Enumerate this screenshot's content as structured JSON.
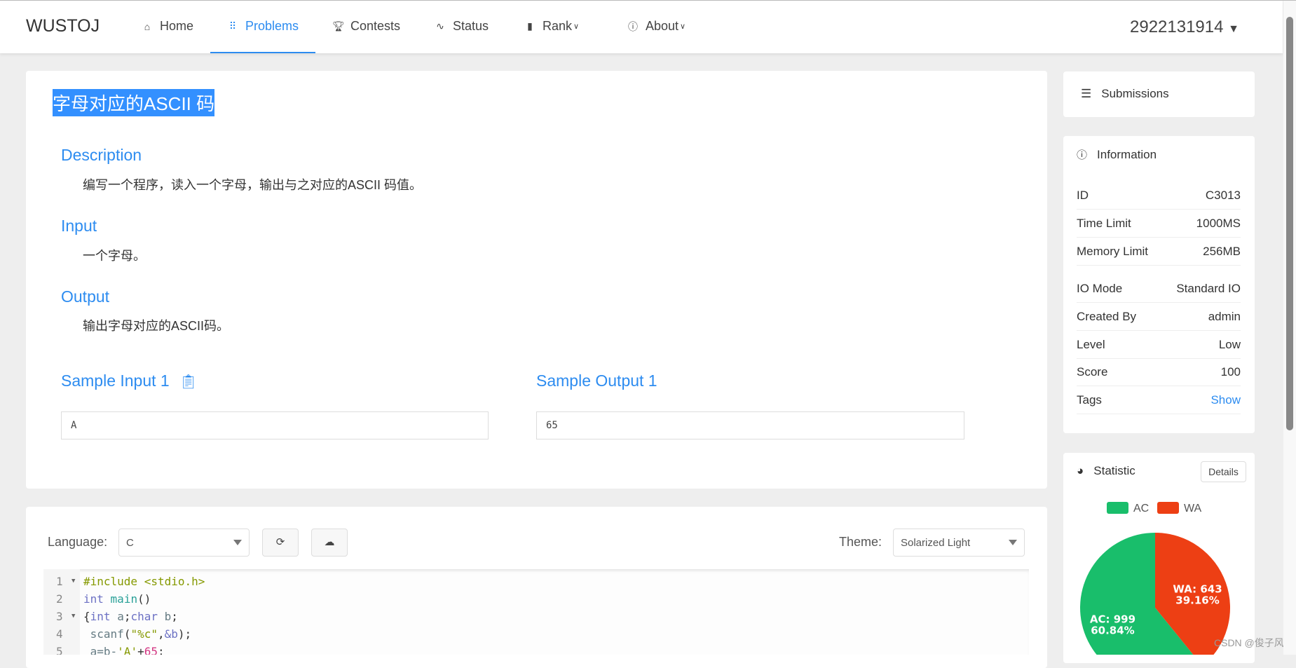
{
  "nav": {
    "logo": "WUSTOJ",
    "items": [
      {
        "label": "Home",
        "icon": "home-icon"
      },
      {
        "label": "Problems",
        "icon": "grid-icon",
        "active": true
      },
      {
        "label": "Contests",
        "icon": "trophy-icon"
      },
      {
        "label": "Status",
        "icon": "pulse-icon"
      },
      {
        "label": "Rank",
        "icon": "bar-chart-icon"
      },
      {
        "label": "About",
        "icon": "info-icon"
      }
    ],
    "user": "2922131914"
  },
  "problem": {
    "title": "字母对应的ASCII 码",
    "description_h": "Description",
    "description": "编写一个程序，读入一个字母，输出与之对应的ASCII 码值。",
    "input_h": "Input",
    "input": "一个字母。",
    "output_h": "Output",
    "output": "输出字母对应的ASCII码。",
    "sample_input_h": "Sample Input 1",
    "sample_input": "A",
    "sample_output_h": "Sample Output 1",
    "sample_output": "65"
  },
  "editor": {
    "language_label": "Language:",
    "language": "C",
    "theme_label": "Theme:",
    "theme": "Solarized Light",
    "lines": [
      "1",
      "2",
      "3",
      "4",
      "5"
    ]
  },
  "sidebar": {
    "submissions": "Submissions",
    "information": "Information",
    "info": [
      {
        "k": "ID",
        "v": "C3013"
      },
      {
        "k": "Time Limit",
        "v": "1000MS"
      },
      {
        "k": "Memory Limit",
        "v": "256MB"
      },
      {
        "k": "IO Mode",
        "v": "Standard IO"
      },
      {
        "k": "Created By",
        "v": "admin"
      },
      {
        "k": "Level",
        "v": "Low"
      },
      {
        "k": "Score",
        "v": "100"
      },
      {
        "k": "Tags",
        "v": "Show"
      }
    ],
    "statistic": "Statistic",
    "details": "Details"
  },
  "chart_data": {
    "type": "pie",
    "series": [
      {
        "name": "AC",
        "value": 999,
        "percent": "60.84%",
        "color": "#19be6b",
        "label": "AC: 999"
      },
      {
        "name": "WA",
        "value": 643,
        "percent": "39.16%",
        "color": "#ed3f14",
        "label": "WA: 643"
      }
    ],
    "legend": "top"
  },
  "watermark": "CSDN @俊子风"
}
